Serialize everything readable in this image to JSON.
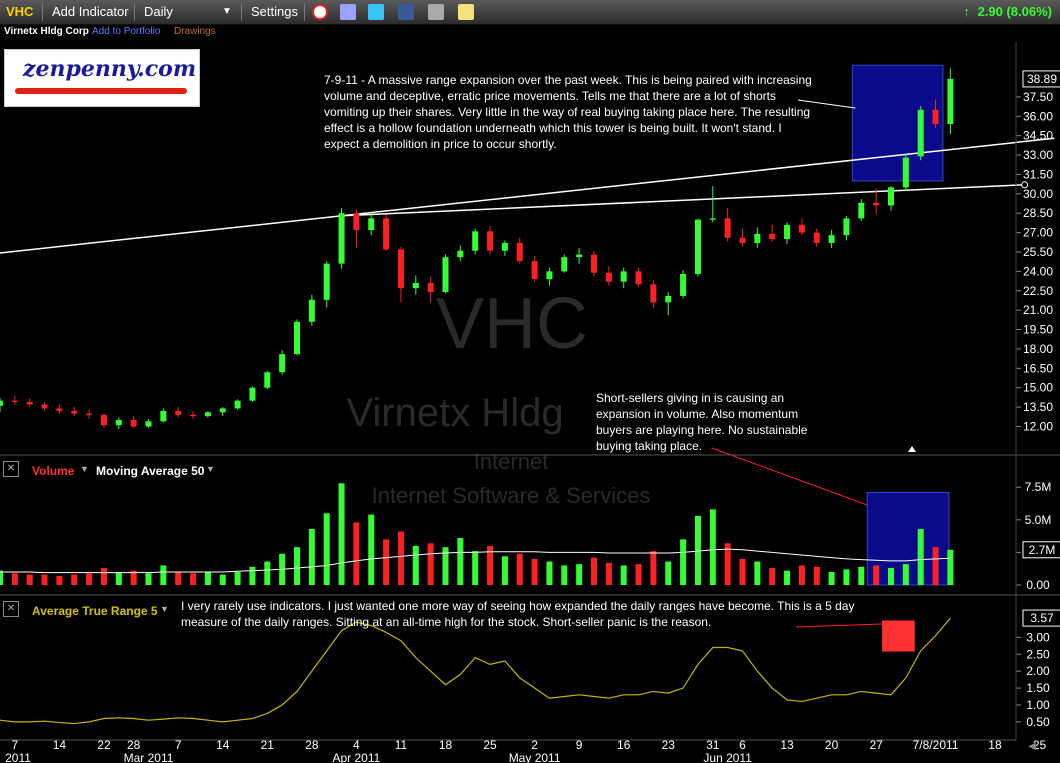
{
  "toolbar": {
    "ticker": "VHC",
    "add_indicator": "Add Indicator",
    "interval": "Daily",
    "settings": "Settings",
    "change": "2.90 (8.06%)"
  },
  "subbar": {
    "company": "Virnetx Hldg Corp",
    "add_portfolio": "Add to Portfolio",
    "drawings": "Drawings"
  },
  "logo": {
    "text": "zenpenny.com"
  },
  "watermark": {
    "symbol": "VHC",
    "name": "Virnetx Hldg",
    "sector": "Internet",
    "industry": "Internet Software & Services"
  },
  "notes": {
    "price": "7-9-11 - A massive range expansion over the past week. This is being paired with increasing volume and deceptive, erratic price movements. Tells me that there are a lot of shorts vomiting up their shares. Very little in the way of real buying taking place here. The resulting effect is a hollow foundation underneath which this tower is being built. It won't stand. I expect a demolition in price to occur shortly.",
    "volume": "Short-sellers giving in is causing an expansion in volume. Also momentum buyers are playing here. No sustainable buying taking place.",
    "atr": "I very rarely use indicators. I just wanted one more way of seeing how expanded the daily ranges have become. This is a 5 day measure of the daily ranges. Sitting at an all-time high for the stock. Short-seller panic is the reason."
  },
  "panes": {
    "volume_label": "Volume",
    "ma_label": "Moving Average 50",
    "atr_label": "Average True Range 5"
  },
  "colors": {
    "up": "#33ff33",
    "down": "#ff2020",
    "highlight": "#0a0a8a",
    "atr_line": "#c8b400",
    "atr_box": "#ff3030"
  },
  "chart_data": [
    {
      "type": "candlestick",
      "title": "VHC",
      "ylim": [
        10.8,
        40.2
      ],
      "y_ticks": [
        "12.00",
        "13.50",
        "15.00",
        "16.50",
        "18.00",
        "19.50",
        "21.00",
        "22.50",
        "24.00",
        "25.50",
        "27.00",
        "28.50",
        "30.00",
        "31.50",
        "33.00",
        "34.50",
        "36.00",
        "37.50"
      ],
      "last_price": "38.89",
      "x_ticks": [
        {
          "i": 1,
          "label": "7"
        },
        {
          "i": 4,
          "label": "14"
        },
        {
          "i": 7,
          "label": "22"
        },
        {
          "i": 9,
          "label": "28"
        },
        {
          "i": 12,
          "label": "7"
        },
        {
          "i": 15,
          "label": "14"
        },
        {
          "i": 18,
          "label": "21"
        },
        {
          "i": 21,
          "label": "28"
        },
        {
          "i": 24,
          "label": "4"
        },
        {
          "i": 27,
          "label": "11"
        },
        {
          "i": 30,
          "label": "18"
        },
        {
          "i": 33,
          "label": "25"
        },
        {
          "i": 36,
          "label": "2"
        },
        {
          "i": 39,
          "label": "9"
        },
        {
          "i": 42,
          "label": "16"
        },
        {
          "i": 45,
          "label": "23"
        },
        {
          "i": 48,
          "label": "31"
        },
        {
          "i": 50,
          "label": "6"
        },
        {
          "i": 53,
          "label": "13"
        },
        {
          "i": 56,
          "label": "20"
        },
        {
          "i": 59,
          "label": "27"
        },
        {
          "i": 63,
          "label": "7/8/2011"
        },
        {
          "i": 67,
          "label": "18"
        },
        {
          "i": 70,
          "label": "25"
        }
      ],
      "month_labels": [
        {
          "i": 0,
          "label": "2011"
        },
        {
          "i": 10,
          "label": "Mar 2011"
        },
        {
          "i": 24,
          "label": "Apr 2011"
        },
        {
          "i": 36,
          "label": "May 2011"
        },
        {
          "i": 49,
          "label": "Jun 2011"
        }
      ],
      "ohlc": [
        [
          13.6,
          14.2,
          13.1,
          14.0
        ],
        [
          14.0,
          14.4,
          13.7,
          13.9
        ],
        [
          13.9,
          14.2,
          13.5,
          13.7
        ],
        [
          13.7,
          13.9,
          13.2,
          13.4
        ],
        [
          13.4,
          13.7,
          13.0,
          13.2
        ],
        [
          13.2,
          13.5,
          12.8,
          13.0
        ],
        [
          13.0,
          13.3,
          12.6,
          12.9
        ],
        [
          12.9,
          13.0,
          11.9,
          12.1
        ],
        [
          12.1,
          12.7,
          11.8,
          12.5
        ],
        [
          12.5,
          12.8,
          11.9,
          12.0
        ],
        [
          12.0,
          12.6,
          11.9,
          12.4
        ],
        [
          12.4,
          13.4,
          12.3,
          13.2
        ],
        [
          13.2,
          13.5,
          12.7,
          12.9
        ],
        [
          12.9,
          13.2,
          12.6,
          12.8
        ],
        [
          12.8,
          13.2,
          12.7,
          13.1
        ],
        [
          13.1,
          13.5,
          12.8,
          13.4
        ],
        [
          13.4,
          14.1,
          13.3,
          14.0
        ],
        [
          14.0,
          15.1,
          13.9,
          15.0
        ],
        [
          15.0,
          16.3,
          14.9,
          16.2
        ],
        [
          16.2,
          17.9,
          16.0,
          17.6
        ],
        [
          17.6,
          20.3,
          17.5,
          20.1
        ],
        [
          20.1,
          22.2,
          19.8,
          21.8
        ],
        [
          21.8,
          24.8,
          21.2,
          24.6
        ],
        [
          24.6,
          28.9,
          24.2,
          28.5
        ],
        [
          28.5,
          28.8,
          25.8,
          27.2
        ],
        [
          27.2,
          28.6,
          26.8,
          28.1
        ],
        [
          28.1,
          28.4,
          25.6,
          25.7
        ],
        [
          25.7,
          25.9,
          21.6,
          22.7
        ],
        [
          22.7,
          23.7,
          22.2,
          23.1
        ],
        [
          23.1,
          23.6,
          21.6,
          22.4
        ],
        [
          22.4,
          25.3,
          22.3,
          25.1
        ],
        [
          25.1,
          26.0,
          24.8,
          25.6
        ],
        [
          25.6,
          27.3,
          25.3,
          27.1
        ],
        [
          27.1,
          27.5,
          25.3,
          25.6
        ],
        [
          25.6,
          26.4,
          25.2,
          26.2
        ],
        [
          26.2,
          26.6,
          24.6,
          24.8
        ],
        [
          24.8,
          25.2,
          23.2,
          23.4
        ],
        [
          23.4,
          24.3,
          22.9,
          24.0
        ],
        [
          24.0,
          25.3,
          23.9,
          25.1
        ],
        [
          25.1,
          25.8,
          24.6,
          25.3
        ],
        [
          25.3,
          25.6,
          23.6,
          23.9
        ],
        [
          23.9,
          24.4,
          22.9,
          23.2
        ],
        [
          23.2,
          24.3,
          22.7,
          24.0
        ],
        [
          24.0,
          24.3,
          22.8,
          23.0
        ],
        [
          23.0,
          23.3,
          21.2,
          21.6
        ],
        [
          21.6,
          22.4,
          20.6,
          22.1
        ],
        [
          22.1,
          24.1,
          21.9,
          23.8
        ],
        [
          23.8,
          28.1,
          23.6,
          28.0
        ],
        [
          28.0,
          30.6,
          27.8,
          28.1
        ],
        [
          28.1,
          28.9,
          26.3,
          26.6
        ],
        [
          26.6,
          27.3,
          25.9,
          26.2
        ],
        [
          26.2,
          27.4,
          25.8,
          26.9
        ],
        [
          26.9,
          27.6,
          26.3,
          26.5
        ],
        [
          26.5,
          27.8,
          26.1,
          27.6
        ],
        [
          27.6,
          28.1,
          26.8,
          27.0
        ],
        [
          27.0,
          27.3,
          25.9,
          26.2
        ],
        [
          26.2,
          27.2,
          25.8,
          26.8
        ],
        [
          26.8,
          28.3,
          26.4,
          28.1
        ],
        [
          28.1,
          29.6,
          27.9,
          29.3
        ],
        [
          29.3,
          30.4,
          28.4,
          29.1
        ],
        [
          29.1,
          30.6,
          28.7,
          30.5
        ],
        [
          30.5,
          33.1,
          30.2,
          32.8
        ],
        [
          32.9,
          36.8,
          32.6,
          36.5
        ],
        [
          36.5,
          37.3,
          35.1,
          35.4
        ],
        [
          35.4,
          39.7,
          34.6,
          38.9
        ]
      ],
      "trendlines": [
        {
          "from": [
            -1,
            25.3
          ],
          "to": [
            71,
            34.3
          ]
        },
        {
          "from": [
            23,
            28.3
          ],
          "to": [
            69,
            30.7
          ]
        }
      ]
    },
    {
      "type": "bar",
      "title": "Volume",
      "ylim": [
        0,
        7.9
      ],
      "y_ticks": [
        "0.00",
        "2.5M",
        "5.0M",
        "7.5M"
      ],
      "last_value": "2.7M",
      "values": [
        1.1,
        0.9,
        0.8,
        0.8,
        0.7,
        0.8,
        0.9,
        1.3,
        1.0,
        1.1,
        0.9,
        1.5,
        1.0,
        0.9,
        1.0,
        0.8,
        1.0,
        1.4,
        1.8,
        2.4,
        2.9,
        4.3,
        5.5,
        7.8,
        4.8,
        5.4,
        3.5,
        4.1,
        3.0,
        3.2,
        2.9,
        3.6,
        2.6,
        3.0,
        2.2,
        2.4,
        2.0,
        1.8,
        1.5,
        1.6,
        2.1,
        1.7,
        1.5,
        1.6,
        2.6,
        1.8,
        3.5,
        5.3,
        5.8,
        3.2,
        2.0,
        1.8,
        1.3,
        1.1,
        1.5,
        1.4,
        1.0,
        1.2,
        1.4,
        1.5,
        1.3,
        1.6,
        4.3,
        2.9,
        2.7
      ],
      "ma50": [
        1.0,
        1.0,
        1.0,
        0.95,
        0.95,
        0.95,
        0.95,
        0.95,
        0.95,
        0.95,
        0.95,
        1.0,
        1.0,
        1.0,
        1.0,
        1.0,
        1.05,
        1.1,
        1.15,
        1.2,
        1.3,
        1.4,
        1.5,
        1.7,
        1.85,
        2.0,
        2.1,
        2.2,
        2.3,
        2.4,
        2.45,
        2.5,
        2.5,
        2.55,
        2.55,
        2.55,
        2.55,
        2.5,
        2.5,
        2.5,
        2.5,
        2.45,
        2.45,
        2.45,
        2.45,
        2.45,
        2.5,
        2.6,
        2.7,
        2.75,
        2.7,
        2.6,
        2.5,
        2.4,
        2.3,
        2.2,
        2.1,
        2.0,
        1.95,
        1.9,
        1.85,
        1.85,
        1.95,
        2.0,
        2.05
      ]
    },
    {
      "type": "line",
      "title": "Average True Range 5",
      "ylim": [
        0.2,
        3.75
      ],
      "y_ticks": [
        "0.50",
        "1.00",
        "1.50",
        "2.00",
        "2.50",
        "3.00"
      ],
      "last_value": "3.57",
      "values": [
        0.55,
        0.5,
        0.5,
        0.52,
        0.48,
        0.45,
        0.5,
        0.6,
        0.62,
        0.6,
        0.55,
        0.58,
        0.62,
        0.6,
        0.55,
        0.5,
        0.55,
        0.6,
        0.75,
        1.0,
        1.4,
        2.0,
        2.6,
        3.2,
        3.45,
        3.35,
        3.15,
        2.9,
        2.4,
        2.0,
        1.6,
        1.9,
        2.4,
        2.2,
        2.3,
        1.8,
        1.5,
        1.2,
        1.25,
        1.3,
        1.25,
        1.2,
        1.3,
        1.3,
        1.4,
        1.35,
        1.5,
        2.2,
        2.7,
        2.7,
        2.6,
        2.0,
        1.5,
        1.15,
        1.1,
        1.2,
        1.3,
        1.3,
        1.4,
        1.35,
        1.3,
        1.8,
        2.6,
        3.05,
        3.57
      ]
    }
  ]
}
